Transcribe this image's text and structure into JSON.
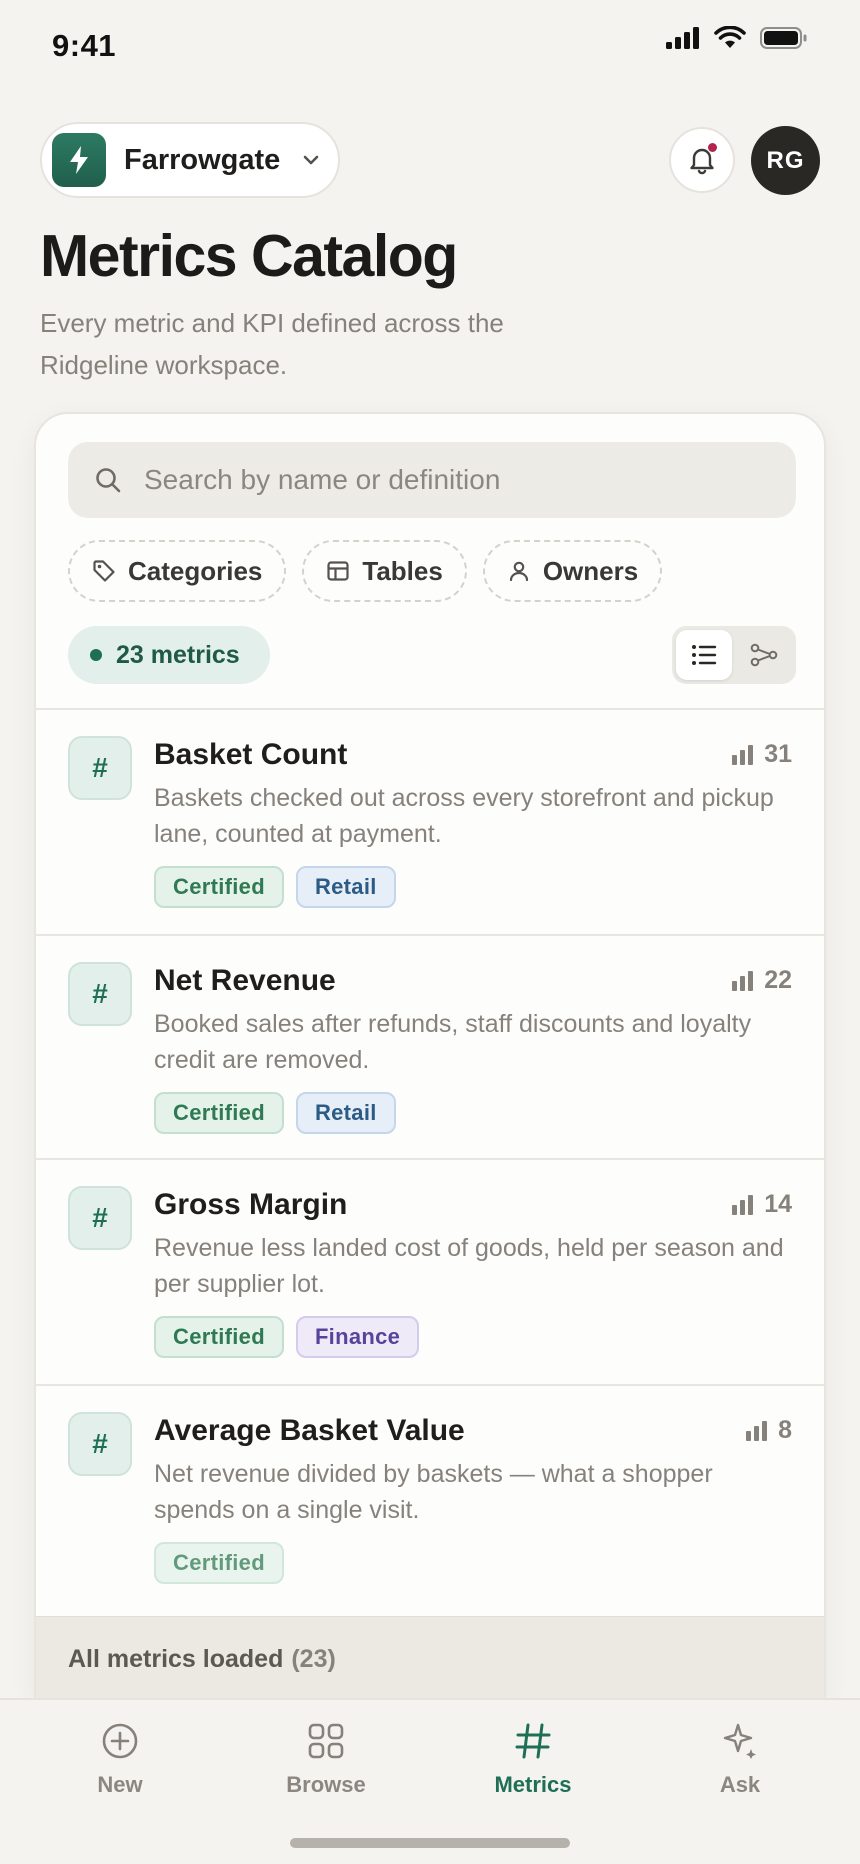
{
  "status_bar": {
    "time": "9:41"
  },
  "header": {
    "workspace_name": "Farrowgate",
    "avatar_initials": "RG",
    "has_notification": true
  },
  "page": {
    "title": "Metrics Catalog",
    "subtitle": "Every metric and KPI defined across the Ridgeline workspace."
  },
  "search": {
    "placeholder": "Search by name or definition",
    "value": ""
  },
  "filters": [
    {
      "label": "Categories",
      "icon": "tag-icon"
    },
    {
      "label": "Tables",
      "icon": "table-icon"
    },
    {
      "label": "Owners",
      "icon": "person-icon"
    }
  ],
  "count_label": "23 metrics",
  "view_modes": {
    "active": "list",
    "options": [
      "list",
      "graph"
    ]
  },
  "metrics": [
    {
      "title": "Basket Count",
      "uses": "31",
      "description": "Baskets checked out across every storefront and pickup lane, counted at payment.",
      "tags": [
        "Certified",
        "Retail"
      ]
    },
    {
      "title": "Net Revenue",
      "uses": "22",
      "description": "Booked sales after refunds, staff discounts and loyalty credit are removed.",
      "tags": [
        "Certified",
        "Retail"
      ]
    },
    {
      "title": "Gross Margin",
      "uses": "14",
      "description": "Revenue less landed cost of goods, held per season and per supplier lot.",
      "tags": [
        "Certified",
        "Finance"
      ]
    },
    {
      "title": "Average Basket Value",
      "uses": "8",
      "description": "Net revenue divided by baskets — what a shopper spends on a single visit.",
      "tags": [
        "Certified"
      ]
    }
  ],
  "footer_status": {
    "label": "All metrics loaded",
    "count": "(23)"
  },
  "tabs": [
    {
      "label": "New",
      "icon": "plus-circle-icon"
    },
    {
      "label": "Browse",
      "icon": "grid-icon"
    },
    {
      "label": "Metrics",
      "icon": "hash-icon",
      "active": true
    },
    {
      "label": "Ask",
      "icon": "sparkle-icon"
    }
  ],
  "colors": {
    "accent": "#1f6f56",
    "background": "#f4f3f0",
    "notification_dot": "#b3234e"
  }
}
